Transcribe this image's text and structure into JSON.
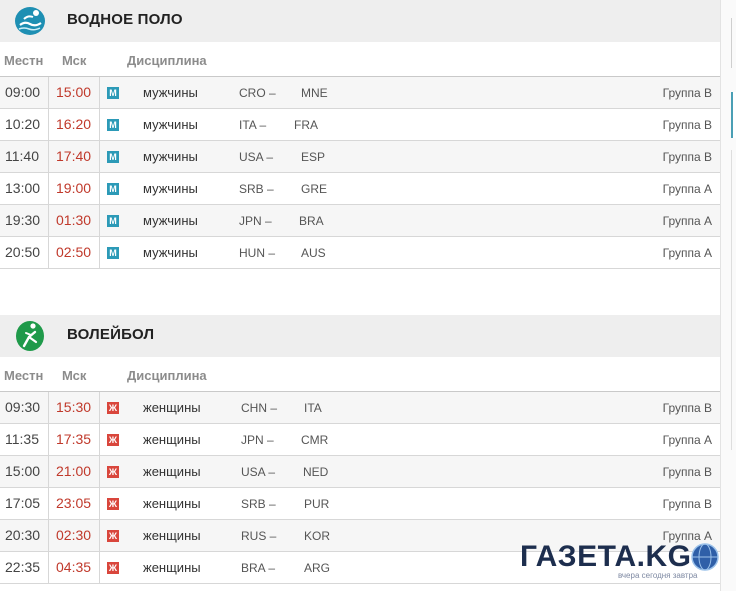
{
  "columns": {
    "local": "Местн",
    "msk": "Мск",
    "discipline": "Дисциплина"
  },
  "colors": {
    "msk_time": "#c0392b",
    "men_badge": "#2c9ab7",
    "women_badge": "#d9463c",
    "header_bg": "#eeeeee"
  },
  "water_polo": {
    "title": "ВОДНОЕ ПОЛО",
    "icon": "water-polo-icon",
    "rows": [
      {
        "local": "09:00",
        "msk": "15:00",
        "badge": "М",
        "gender": "мужчины",
        "team1": "CRO –",
        "team2": "MNE",
        "group": "Группа B"
      },
      {
        "local": "10:20",
        "msk": "16:20",
        "badge": "М",
        "gender": "мужчины",
        "team1": "ITA –",
        "team2": "FRA",
        "group": "Группа B"
      },
      {
        "local": "11:40",
        "msk": "17:40",
        "badge": "М",
        "gender": "мужчины",
        "team1": "USA –",
        "team2": "ESP",
        "group": "Группа B"
      },
      {
        "local": "13:00",
        "msk": "19:00",
        "badge": "М",
        "gender": "мужчины",
        "team1": "SRB –",
        "team2": "GRE",
        "group": "Группа А"
      },
      {
        "local": "19:30",
        "msk": "01:30",
        "badge": "М",
        "gender": "мужчины",
        "team1": "JPN –",
        "team2": "BRA",
        "group": "Группа А"
      },
      {
        "local": "20:50",
        "msk": "02:50",
        "badge": "М",
        "gender": "мужчины",
        "team1": "HUN –",
        "team2": "AUS",
        "group": "Группа А"
      }
    ]
  },
  "volleyball": {
    "title": "ВОЛЕЙБОЛ",
    "icon": "volleyball-icon",
    "rows": [
      {
        "local": "09:30",
        "msk": "15:30",
        "badge": "Ж",
        "gender": "женщины",
        "team1": "CHN –",
        "team2": "ITA",
        "group": "Группа B"
      },
      {
        "local": "11:35",
        "msk": "17:35",
        "badge": "Ж",
        "gender": "женщины",
        "team1": "JPN –",
        "team2": "CMR",
        "group": "Группа А"
      },
      {
        "local": "15:00",
        "msk": "21:00",
        "badge": "Ж",
        "gender": "женщины",
        "team1": "USA –",
        "team2": "NED",
        "group": "Группа B"
      },
      {
        "local": "17:05",
        "msk": "23:05",
        "badge": "Ж",
        "gender": "женщины",
        "team1": "SRB –",
        "team2": "PUR",
        "group": "Группа B"
      },
      {
        "local": "20:30",
        "msk": "02:30",
        "badge": "Ж",
        "gender": "женщины",
        "team1": "RUS –",
        "team2": "KOR",
        "group": "Группа А"
      },
      {
        "local": "22:35",
        "msk": "04:35",
        "badge": "Ж",
        "gender": "женщины",
        "team1": "BRA –",
        "team2": "ARG",
        "group": ""
      }
    ]
  },
  "watermark": {
    "name": "ГАЗЕТА.KG",
    "tagline": "вчера сегодня завтра",
    "icon": "globe-icon"
  }
}
